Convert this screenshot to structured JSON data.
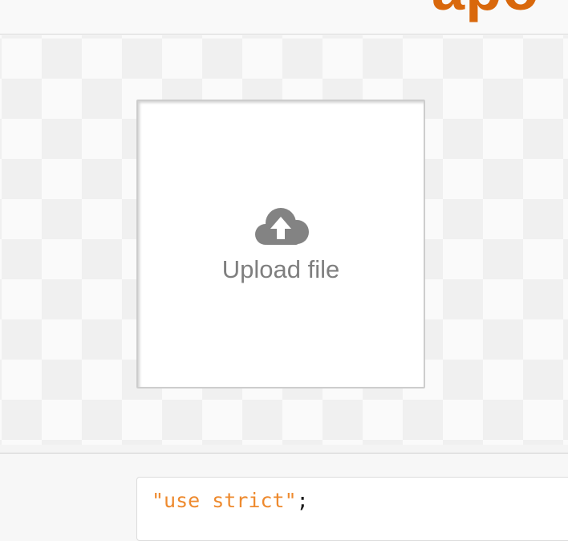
{
  "header": {
    "logo_text": "apo",
    "brand_color": "#d9680c"
  },
  "dropzone": {
    "icon": "cloud-upload-icon",
    "label": "Upload file"
  },
  "code": {
    "string_literal": "\"use strict\"",
    "terminator": ";",
    "string_color": "#ee8a2e"
  }
}
